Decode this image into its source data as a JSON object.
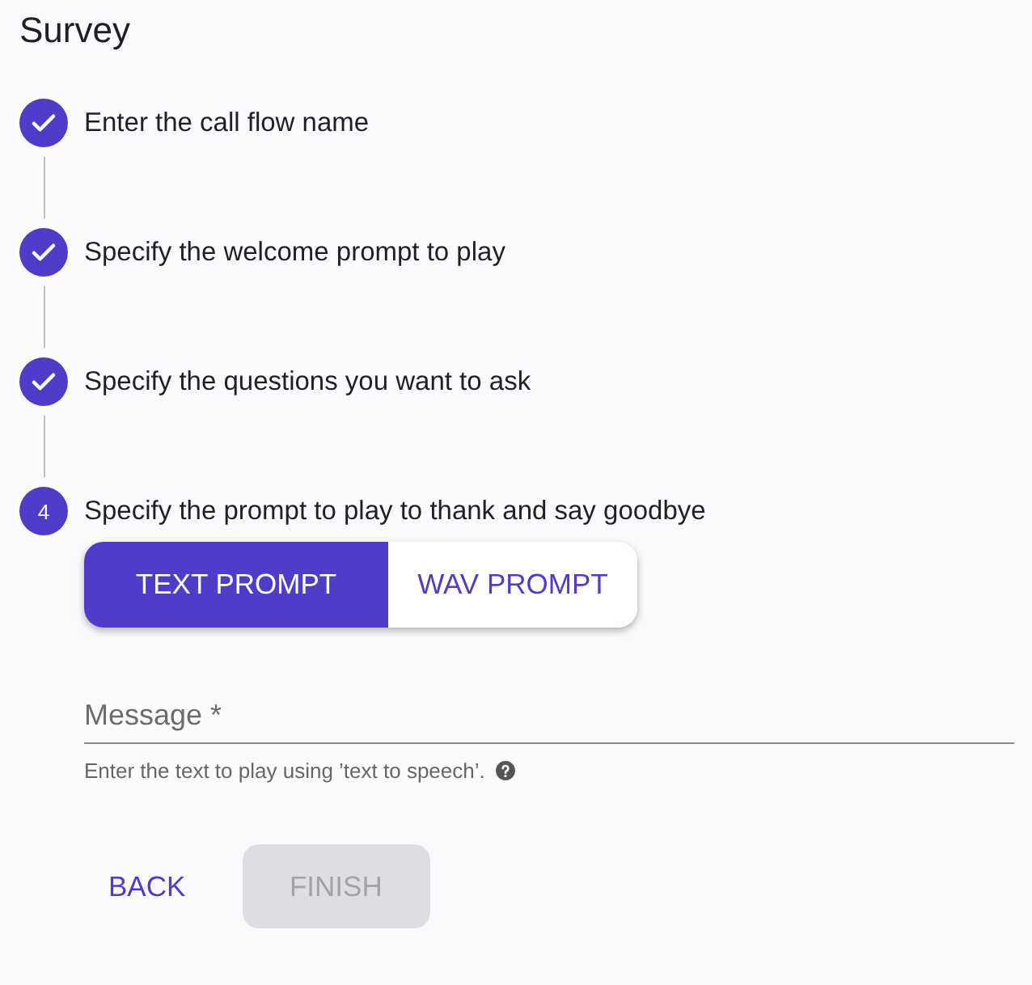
{
  "title": "Survey",
  "steps": [
    {
      "kind": "done",
      "label": "Enter the call flow name"
    },
    {
      "kind": "done",
      "label": "Specify the welcome prompt to play"
    },
    {
      "kind": "done",
      "label": "Specify the questions you want to ask"
    },
    {
      "kind": "active",
      "number": "4",
      "label": "Specify the prompt to play to thank and say goodbye"
    }
  ],
  "prompt_tabs": [
    {
      "label": "TEXT PROMPT",
      "selected": true
    },
    {
      "label": "WAV PROMPT",
      "selected": false
    }
  ],
  "message_field": {
    "placeholder": "Message *",
    "helper": "Enter the text to play using ’text to speech’."
  },
  "buttons": [
    {
      "label": "BACK",
      "disabled": false
    },
    {
      "label": "FINISH",
      "disabled": true
    }
  ]
}
